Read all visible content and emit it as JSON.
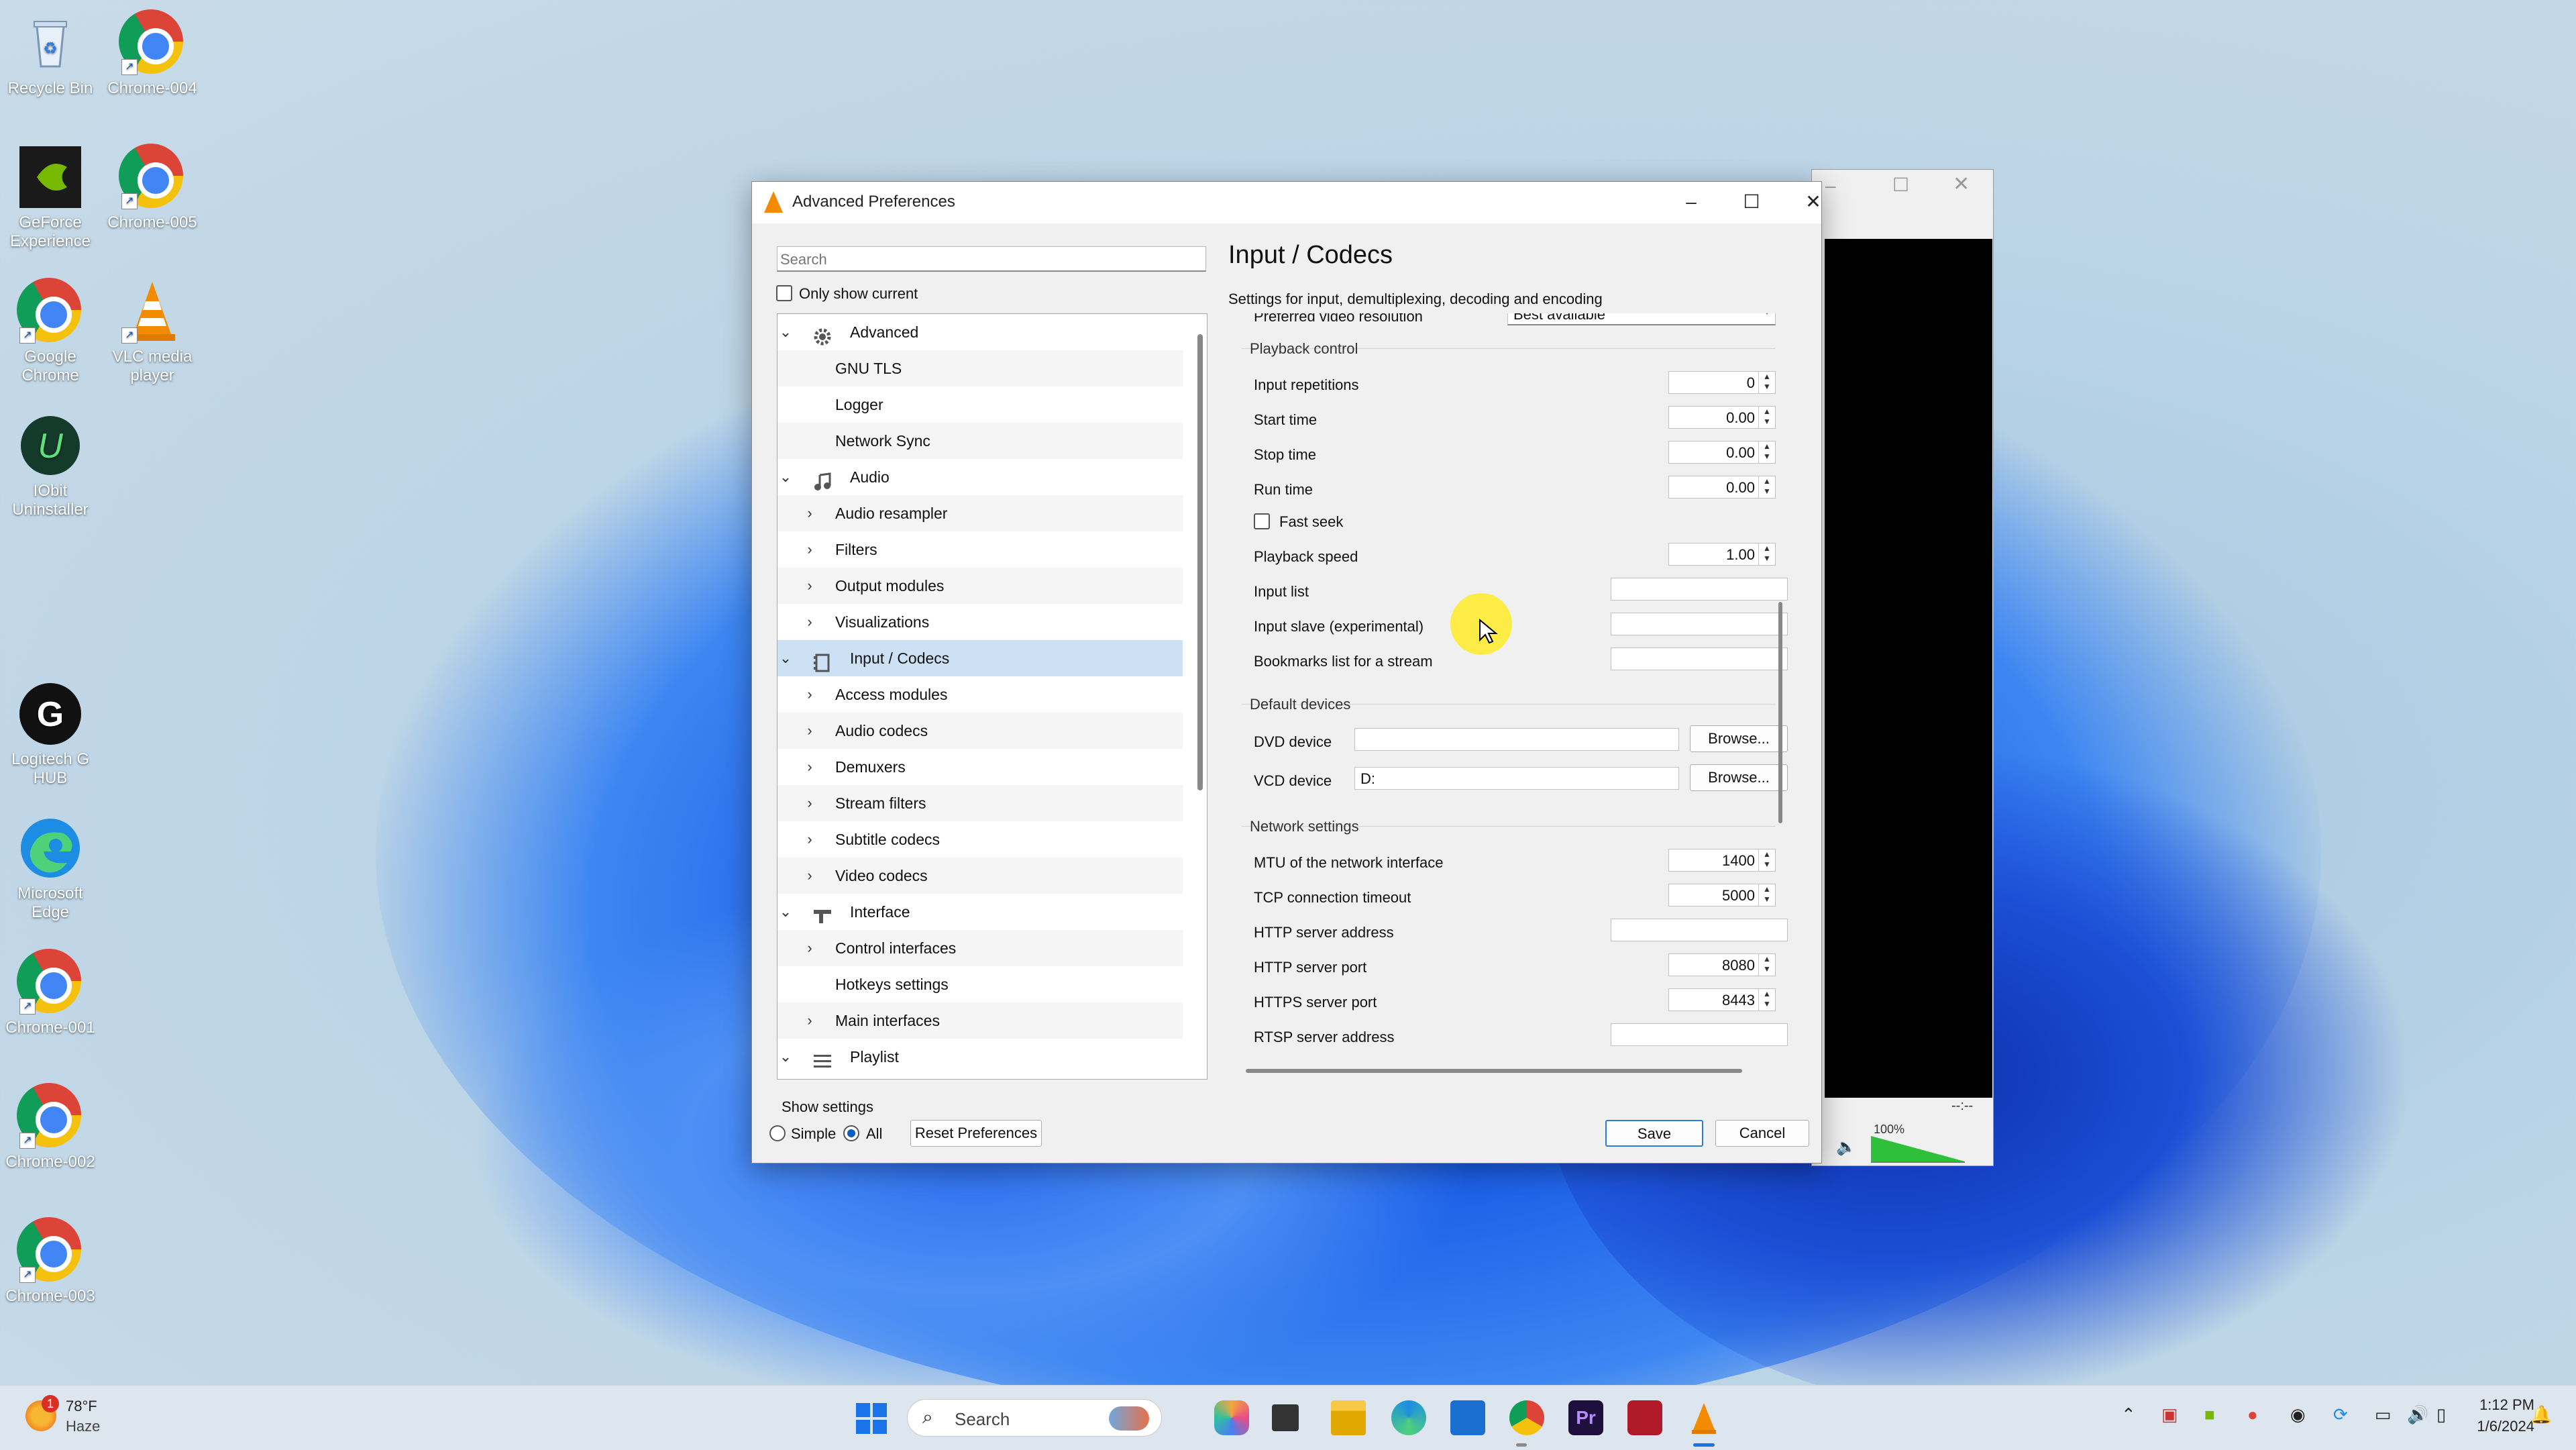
{
  "desktop": {
    "icons": [
      {
        "label": "Recycle Bin"
      },
      {
        "label": "Chrome-004"
      },
      {
        "label": "GeForce Experience"
      },
      {
        "label": "Chrome-005"
      },
      {
        "label": "Google Chrome"
      },
      {
        "label": "VLC media player"
      },
      {
        "label": "IObit Uninstaller"
      },
      {
        "label": "Logitech G HUB"
      },
      {
        "label": "Microsoft Edge"
      },
      {
        "label": "Chrome-001"
      },
      {
        "label": "Chrome-002"
      },
      {
        "label": "Chrome-003"
      }
    ]
  },
  "dialog": {
    "title": "Advanced Preferences",
    "search_placeholder": "Search",
    "only_show_current": "Only show current",
    "tree": [
      {
        "label": "Advanced",
        "level": 0,
        "expander": "v",
        "icon": "gear-icon"
      },
      {
        "label": "GNU TLS",
        "level": 1,
        "expander": ""
      },
      {
        "label": "Logger",
        "level": 1,
        "expander": ""
      },
      {
        "label": "Network Sync",
        "level": 1,
        "expander": ""
      },
      {
        "label": "Audio",
        "level": 0,
        "expander": "v",
        "icon": "music-note-icon"
      },
      {
        "label": "Audio resampler",
        "level": 1,
        "expander": ">"
      },
      {
        "label": "Filters",
        "level": 1,
        "expander": ">"
      },
      {
        "label": "Output modules",
        "level": 1,
        "expander": ">"
      },
      {
        "label": "Visualizations",
        "level": 1,
        "expander": ">"
      },
      {
        "label": "Input / Codecs",
        "level": 0,
        "expander": "v",
        "icon": "film-icon",
        "selected": true
      },
      {
        "label": "Access modules",
        "level": 1,
        "expander": ">"
      },
      {
        "label": "Audio codecs",
        "level": 1,
        "expander": ">"
      },
      {
        "label": "Demuxers",
        "level": 1,
        "expander": ">"
      },
      {
        "label": "Stream filters",
        "level": 1,
        "expander": ">"
      },
      {
        "label": "Subtitle codecs",
        "level": 1,
        "expander": ">"
      },
      {
        "label": "Video codecs",
        "level": 1,
        "expander": ">"
      },
      {
        "label": "Interface",
        "level": 0,
        "expander": "v",
        "icon": "interface-icon"
      },
      {
        "label": "Control interfaces",
        "level": 1,
        "expander": ">"
      },
      {
        "label": "Hotkeys settings",
        "level": 1,
        "expander": ""
      },
      {
        "label": "Main interfaces",
        "level": 1,
        "expander": ">"
      },
      {
        "label": "Playlist",
        "level": 0,
        "expander": "v",
        "icon": "playlist-icon"
      }
    ],
    "heading": "Input / Codecs",
    "subheading": "Settings for input, demultiplexing, decoding and encoding",
    "preferred_video_resolution": {
      "label": "Preferred video resolution",
      "value": "Best available"
    },
    "playback_control": {
      "title": "Playback control",
      "input_repetitions": {
        "label": "Input repetitions",
        "value": "0"
      },
      "start_time": {
        "label": "Start time",
        "value": "0.00"
      },
      "stop_time": {
        "label": "Stop time",
        "value": "0.00"
      },
      "run_time": {
        "label": "Run time",
        "value": "0.00"
      },
      "fast_seek": {
        "label": "Fast seek"
      },
      "playback_speed": {
        "label": "Playback speed",
        "value": "1.00"
      },
      "input_list": {
        "label": "Input list",
        "value": ""
      },
      "input_slave": {
        "label": "Input slave (experimental)",
        "value": ""
      },
      "bookmarks": {
        "label": "Bookmarks list for a stream",
        "value": ""
      }
    },
    "default_devices": {
      "title": "Default devices",
      "dvd": {
        "label": "DVD device",
        "value": "",
        "browse": "Browse..."
      },
      "vcd": {
        "label": "VCD device",
        "value": "D:",
        "browse": "Browse..."
      }
    },
    "network": {
      "title": "Network settings",
      "mtu": {
        "label": "MTU of the network interface",
        "value": "1400"
      },
      "tcp_timeout": {
        "label": "TCP connection timeout",
        "value": "5000"
      },
      "http_addr": {
        "label": "HTTP server address",
        "value": ""
      },
      "http_port": {
        "label": "HTTP server port",
        "value": "8080"
      },
      "https_port": {
        "label": "HTTPS server port",
        "value": "8443"
      },
      "rtsp_addr": {
        "label": "RTSP server address",
        "value": ""
      }
    },
    "show_settings": {
      "title": "Show settings",
      "simple": "Simple",
      "all": "All",
      "selected": "All"
    },
    "reset": "Reset Preferences",
    "save": "Save",
    "cancel": "Cancel"
  },
  "vlc_player": {
    "volume": "100%",
    "time": "--:--"
  },
  "taskbar": {
    "weather_temp": "78°F",
    "weather_desc": "Haze",
    "weather_badge": "1",
    "search_label": "Search",
    "time": "1:12 PM",
    "date": "1/6/2024"
  },
  "colors": {
    "accent": "#0b5fbf",
    "selection": "#cce1f4",
    "vlc_orange": "#f28b00"
  }
}
